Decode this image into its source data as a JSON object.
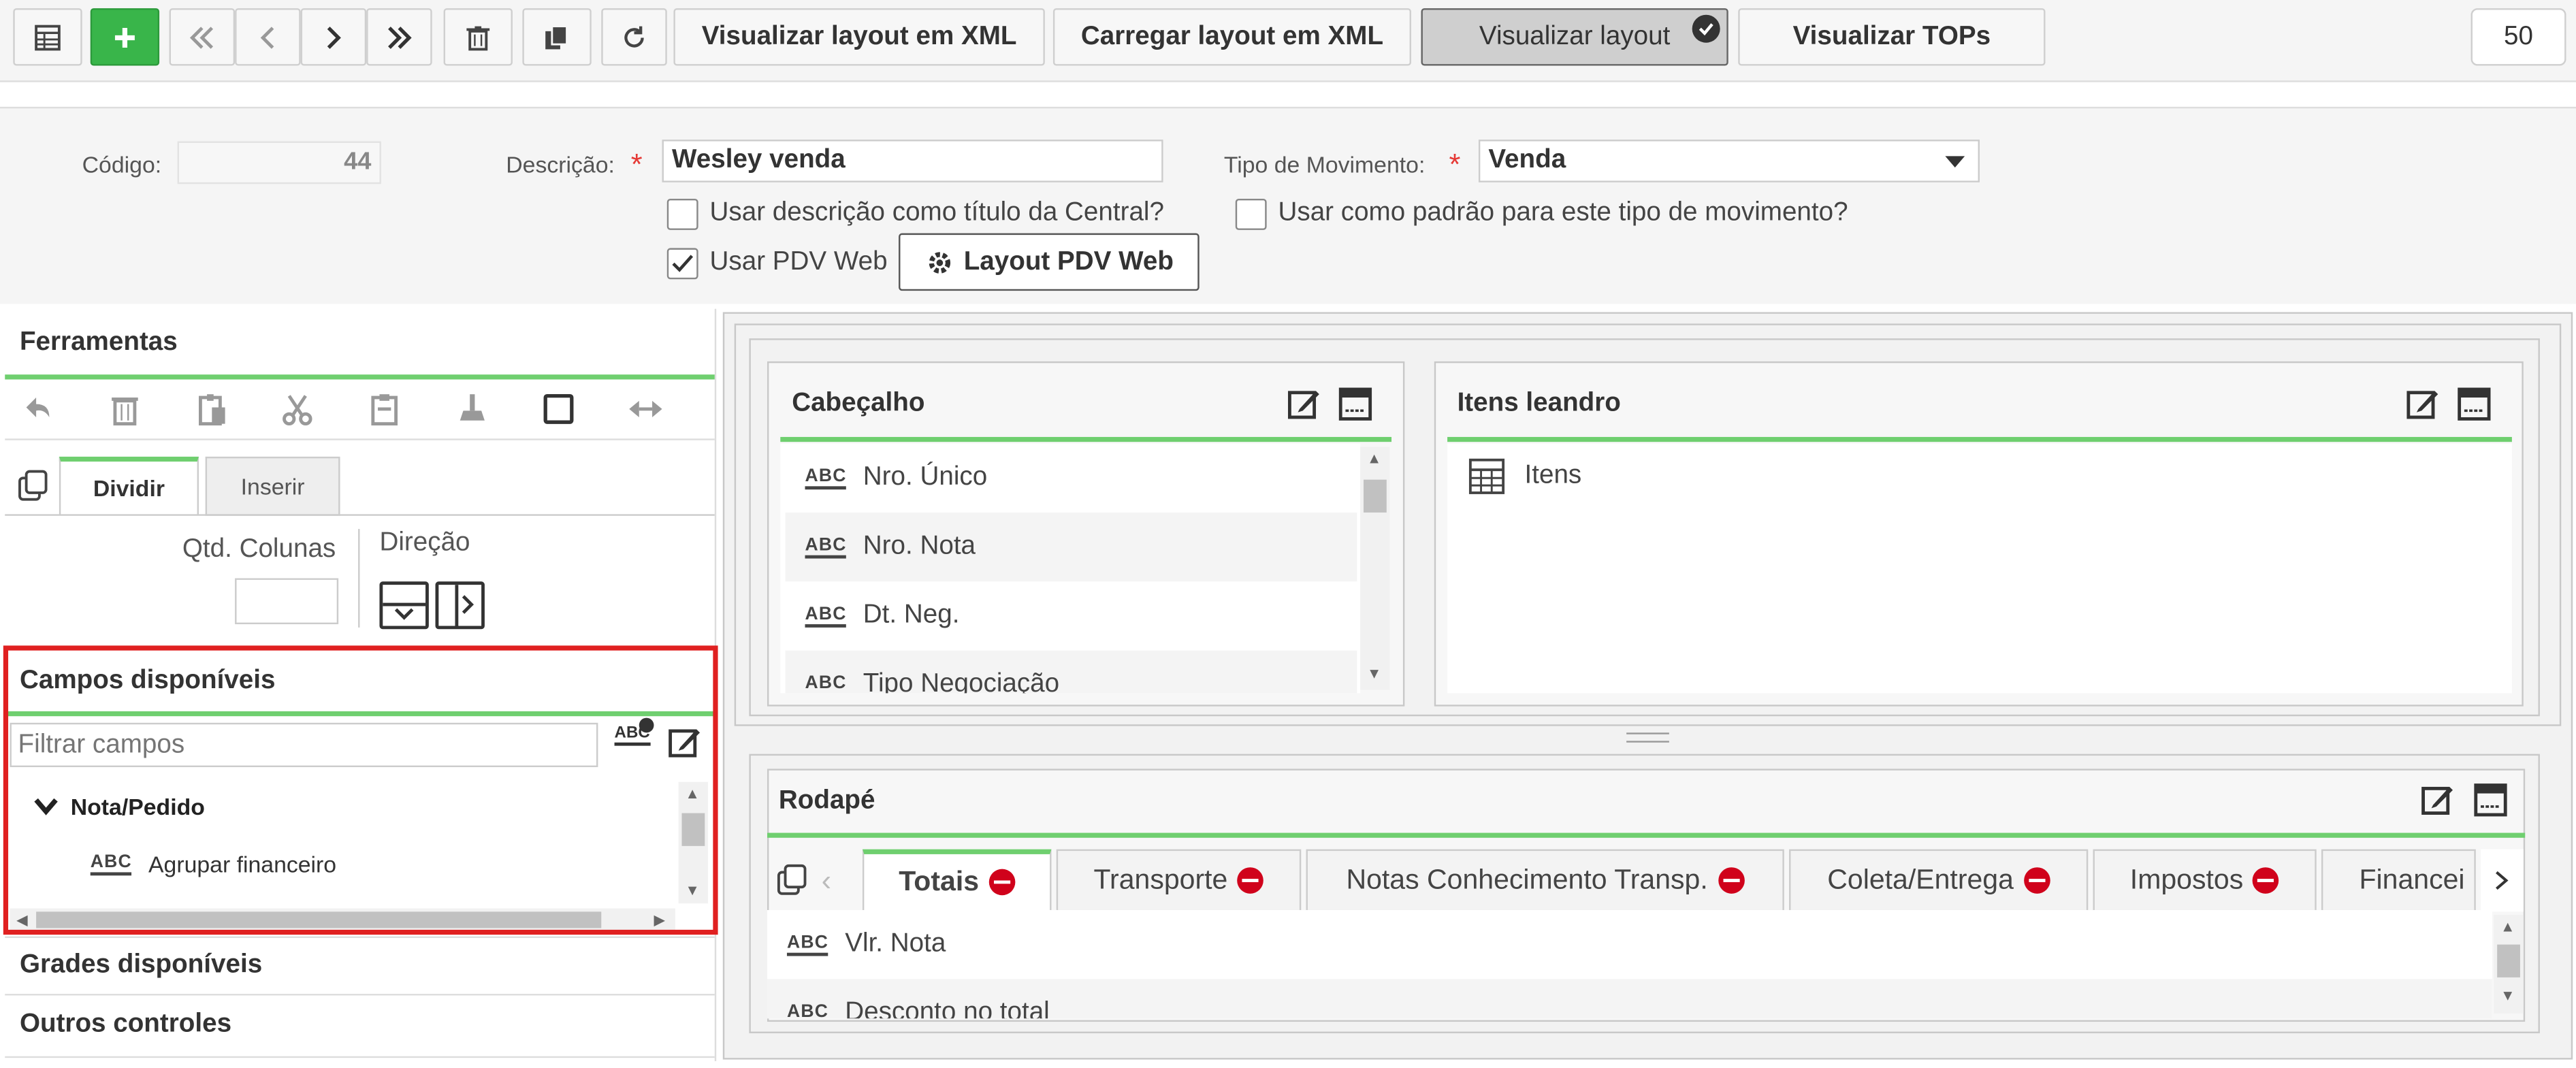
{
  "toolbar": {
    "buttons": {
      "view_xml": "Visualizar layout em XML",
      "load_xml": "Carregar layout em XML",
      "view_layout": "Visualizar layout",
      "view_tops": "Visualizar TOPs"
    },
    "page_size": "50"
  },
  "form": {
    "codigo_label": "Código:",
    "codigo_value": "44",
    "descricao_label": "Descrição:",
    "descricao_value": "Wesley venda",
    "tipo_label": "Tipo de Movimento:",
    "tipo_value": "Venda",
    "cb_desc_title": "Usar descrição como título da Central?",
    "cb_pdv_web": "Usar PDV Web",
    "cb_padrao": "Usar como padrão para este tipo de movimento?",
    "layout_pdv_button": "Layout PDV Web",
    "checked": {
      "desc_title": false,
      "pdv_web": true,
      "padrao": false
    }
  },
  "left": {
    "ferramentas_title": "Ferramentas",
    "tabs": [
      "Dividir",
      "Inserir"
    ],
    "qtd_colunas_label": "Qtd. Colunas",
    "direcao_label": "Direção",
    "campos_title": "Campos disponíveis",
    "filter_placeholder": "Filtrar campos",
    "tree_group": "Nota/Pedido",
    "tree_item": "Agrupar financeiro",
    "grades_title": "Grades disponíveis",
    "outros_title": "Outros controles"
  },
  "cabecalho": {
    "title": "Cabeçalho",
    "fields": [
      "Nro. Único",
      "Nro. Nota",
      "Dt. Neg.",
      "Tipo Negociação"
    ]
  },
  "itens": {
    "title": "Itens leandro",
    "item": "Itens"
  },
  "rodape": {
    "title": "Rodapé",
    "tabs": [
      "Totais",
      "Transporte",
      "Notas Conhecimento Transp.",
      "Coleta/Entrega",
      "Impostos",
      "Financei"
    ],
    "fields": [
      "Vlr. Nota",
      "Desconto no total"
    ]
  },
  "colors": {
    "accent_green": "#6fcf6f",
    "add_button": "#39b54a",
    "highlight_border": "#e02020",
    "remove_badge": "#d0021b"
  }
}
